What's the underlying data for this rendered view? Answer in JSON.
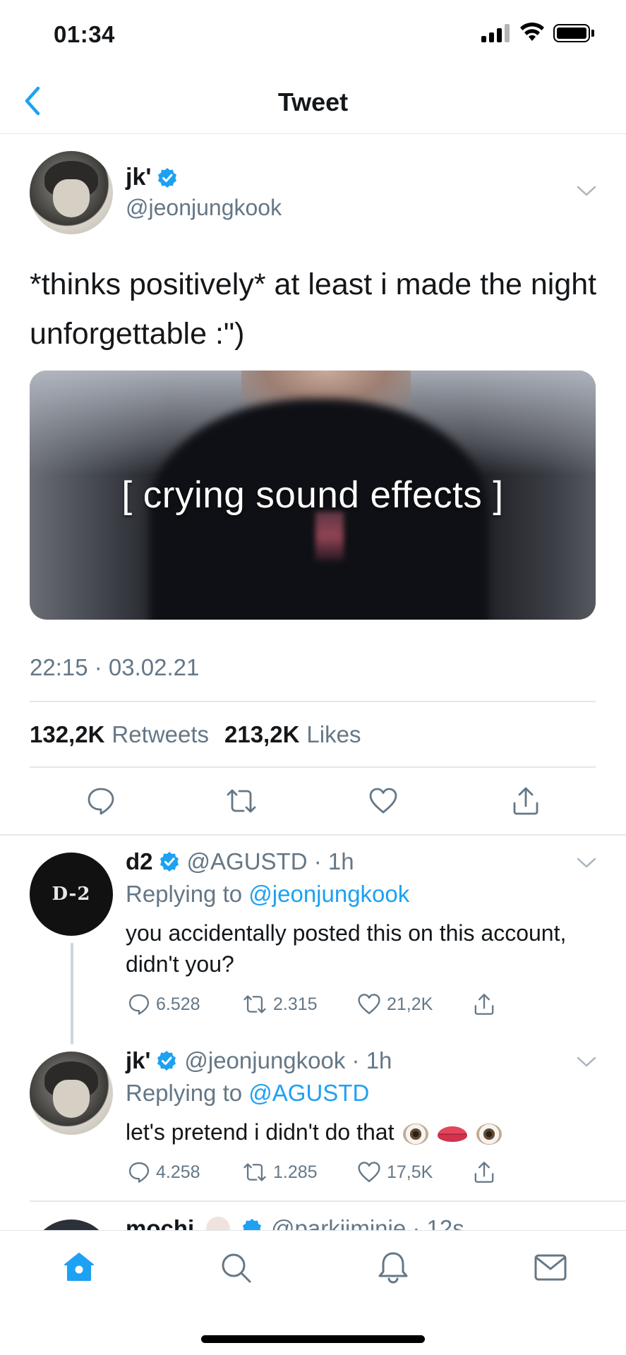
{
  "status_bar": {
    "time": "01:34"
  },
  "nav": {
    "title": "Tweet"
  },
  "tweet": {
    "name": "jk'",
    "handle": "@jeonjungkook",
    "text": "*thinks positively* at least i made the night unforgettable :\")",
    "media_caption": "[ crying sound effects ]",
    "timestamp": "22:15 · 03.02.21",
    "retweets_count": "132,2K",
    "retweets_label": "Retweets",
    "likes_count": "213,2K",
    "likes_label": "Likes"
  },
  "replies": [
    {
      "name": "d2",
      "handle": "@AGUSTD · 1h",
      "replying_prefix": "Replying to",
      "replying_to": "@jeonjungkook",
      "text": "you accidentally posted this on this account, didn't you?",
      "reply_count": "6.528",
      "retweet_count": "2.315",
      "like_count": "21,2K",
      "avatar_text": "D-2"
    },
    {
      "name": "jk'",
      "handle": "@jeonjungkook · 1h",
      "replying_prefix": "Replying to",
      "replying_to": "@AGUSTD",
      "text": "let's pretend i didn't do that",
      "reply_count": "4.258",
      "retweet_count": "1.285",
      "like_count": "17,5K"
    }
  ],
  "partial_reply": {
    "name": "mochi",
    "handle": "@parkjiminie · 12s"
  },
  "colors": {
    "accent": "#1da1f2",
    "secondary_text": "#657786",
    "divider": "#e1e8ed"
  }
}
